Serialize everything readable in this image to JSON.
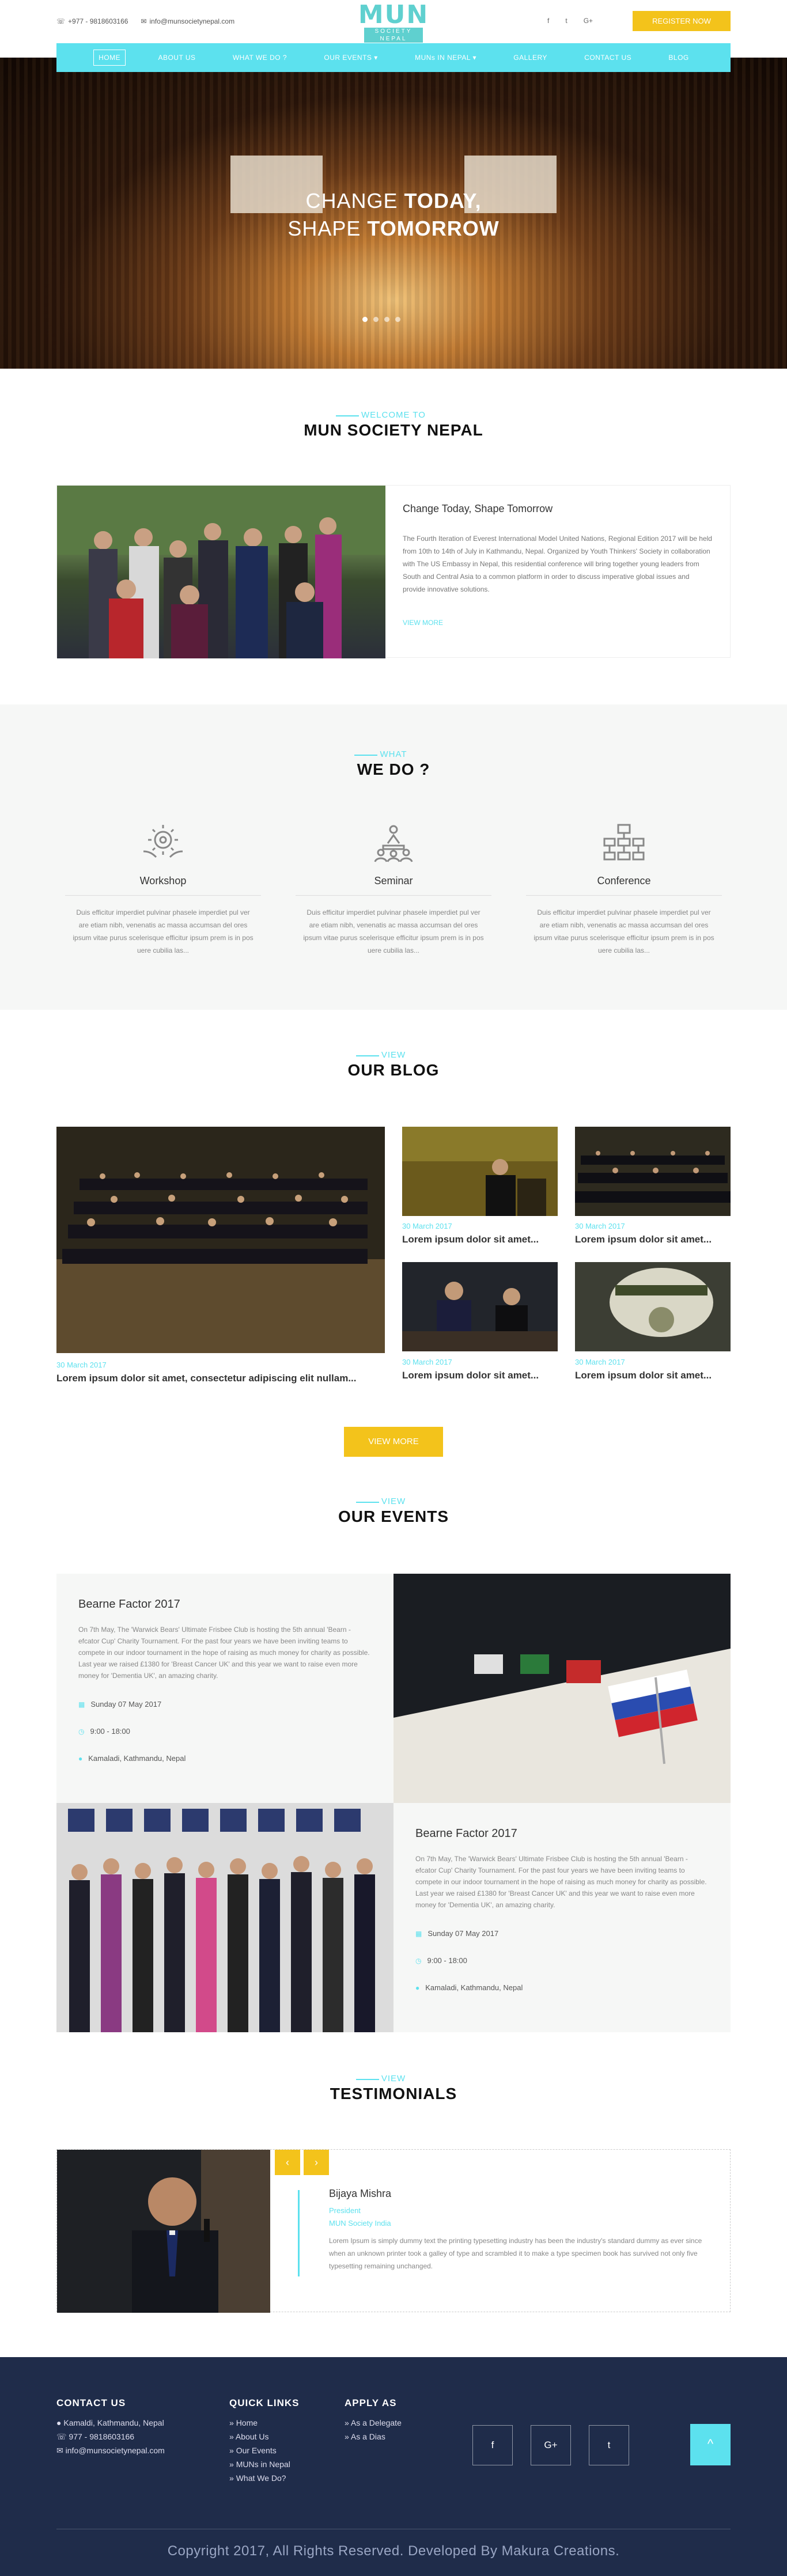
{
  "topbar": {
    "phone": "+977 - 9818603166",
    "email": "info@munsocietynepal.com",
    "logo_mark": "MUN",
    "logo_sub": "SOCIETY NEPAL",
    "social": [
      "f",
      "t",
      "G+"
    ],
    "register_label": "REGISTER NOW"
  },
  "nav": {
    "items": [
      "HOME",
      "ABOUT US",
      "WHAT WE DO ?",
      "OUR EVENTS",
      "MUNs IN NEPAL",
      "GALLERY",
      "CONTACT US",
      "BLOG"
    ]
  },
  "hero": {
    "line1_light": "CHANGE ",
    "line1_bold": "TODAY,",
    "line2_light": "SHAPE ",
    "line2_bold": "TOMORROW",
    "slides": 4,
    "active_slide": 1
  },
  "welcome": {
    "pre": "WELCOME TO",
    "title": "MUN SOCIETY NEPAL",
    "heading": "Change Today, Shape Tomorrow",
    "body": "The Fourth Iteration of Everest International Model United Nations, Regional Edition 2017 will be held from 10th to 14th of July in Kathmandu, Nepal. Organized by Youth Thinkers' Society in collaboration with The US Embassy in Nepal, this residential conference will bring together young leaders from South and Central Asia to a common platform in order to discuss imperative global issues and provide innovative solutions.",
    "more": "VIEW MORE"
  },
  "what_we_do": {
    "pre": "WHAT",
    "title": "WE DO ?",
    "services": [
      {
        "name": "Workshop",
        "icon": "gear-hands-icon",
        "text": "Duis efficitur imperdiet pulvinar phasele imperdiet pul ver are etiam nibh, venenatis ac massa accumsan del ores ipsum vitae purus scelerisque efficitur ipsum prem is in pos uere cubilia las..."
      },
      {
        "name": "Seminar",
        "icon": "presentation-icon",
        "text": "Duis efficitur imperdiet pulvinar phasele imperdiet pul ver are etiam nibh, venenatis ac massa accumsan del ores ipsum vitae purus scelerisque efficitur ipsum prem is in pos uere cubilia las..."
      },
      {
        "name": "Conference",
        "icon": "network-icon",
        "text": "Duis efficitur imperdiet pulvinar phasele imperdiet pul ver are etiam nibh, venenatis ac massa accumsan del ores ipsum vitae purus scelerisque efficitur ipsum prem is in pos uere cubilia las..."
      }
    ]
  },
  "blog": {
    "pre": "VIEW",
    "title": "OUR BLOG",
    "featured": {
      "date": "30 March 2017",
      "title": "Lorem ipsum dolor sit amet, consectetur adipiscing elit nullam..."
    },
    "posts": [
      {
        "date": "30 March 2017",
        "title": "Lorem ipsum dolor sit amet..."
      },
      {
        "date": "30 March 2017",
        "title": "Lorem ipsum dolor sit amet..."
      },
      {
        "date": "30 March 2017",
        "title": "Lorem ipsum dolor sit amet..."
      },
      {
        "date": "30 March 2017",
        "title": "Lorem ipsum dolor sit amet..."
      }
    ],
    "view_more": "VIEW MORE"
  },
  "events": {
    "pre": "VIEW",
    "title": "OUR EVENTS",
    "items": [
      {
        "title": "Bearne Factor 2017",
        "body": "On 7th May, The 'Warwick Bears' Ultimate Frisbee Club is hosting the 5th annual 'Bearn -efcator Cup' Charity Tournament. For the past four years we have been inviting teams to compete in our indoor tournament in the hope of raising as much money for charity as possible. Last year we raised £1380 for 'Breast Cancer UK' and this year we want to raise even more money for 'Dementia UK', an amazing charity.",
        "date": "Sunday 07 May 2017",
        "time": "9:00 - 18:00",
        "place": "Kamaladi, Kathmandu, Nepal"
      },
      {
        "title": "Bearne Factor 2017",
        "body": "On 7th May, The 'Warwick Bears' Ultimate Frisbee Club is hosting the 5th annual 'Bearn -efcator Cup' Charity Tournament. For the past four years we have been inviting teams to compete in our indoor tournament in the hope of raising as much money for charity as possible. Last year we raised £1380 for 'Breast Cancer UK' and this year we want to raise even more money for 'Dementia UK', an amazing charity.",
        "date": "Sunday 07 May 2017",
        "time": "9:00 - 18:00",
        "place": "Kamaladi, Kathmandu, Nepal"
      }
    ]
  },
  "testimonials": {
    "pre": "VIEW",
    "title": "TESTIMONIALS",
    "prev": "‹",
    "next": "›",
    "name": "Bijaya Mishra",
    "role": "President",
    "org": "MUN Society India",
    "quote": "Lorem Ipsum is simply dummy text the printing typesetting industry has been the industry's standard dummy as ever since when an unknown printer took a galley of type and scrambled it to make a type specimen book has survived not only five typesetting remaining unchanged."
  },
  "footer": {
    "contact_title": "CONTACT US",
    "address": "Kamaldi, Kathmandu, Nepal",
    "phone": "977 - 9818603166",
    "email": "info@munsocietynepal.com",
    "quick_title": "QUICK LINKS",
    "quick_links": [
      "Home",
      "About Us",
      "Our Events",
      "MUNs in Nepal",
      "What We Do?"
    ],
    "apply_title": "APPLY AS",
    "apply_links": [
      "As a Delegate",
      "As a Dias"
    ],
    "social": [
      "f",
      "G+",
      "t"
    ],
    "to_top": "^",
    "copyright": "Copyright 2017, All Rights Reserved. Developed By Makura Creations."
  },
  "colors": {
    "accent": "#5ce1ee",
    "brand_yellow": "#f3c31b",
    "footer_bg": "#1f2c4a"
  }
}
